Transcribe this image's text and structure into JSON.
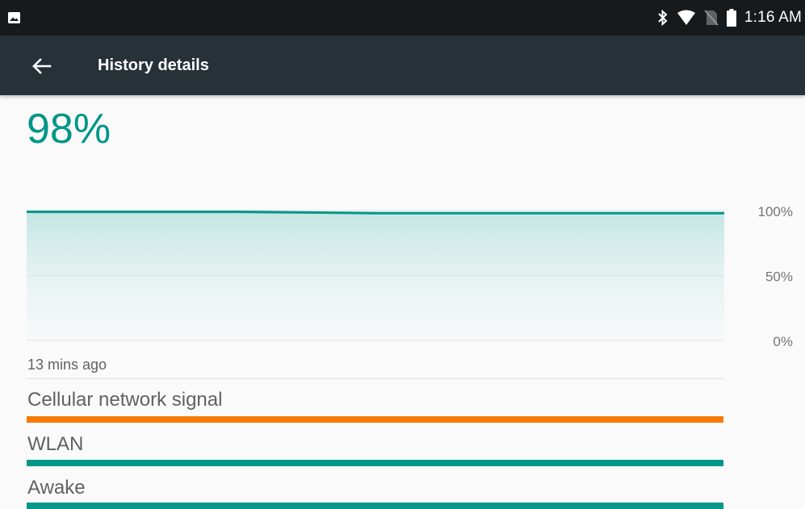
{
  "status_bar": {
    "time": "1:16 AM",
    "icons": [
      "image-icon",
      "bluetooth-icon",
      "wifi-icon",
      "no-sim-icon",
      "battery-icon"
    ]
  },
  "toolbar": {
    "title": "History details",
    "back_icon": "arrow-back-icon"
  },
  "battery": {
    "level_text": "98%"
  },
  "chart_data": {
    "type": "area",
    "x_start_label": "13 mins ago",
    "y_ticks": [
      "100%",
      "50%",
      "0%"
    ],
    "ylim": [
      0,
      100
    ],
    "values": [
      99,
      99,
      99,
      99,
      98.5,
      98,
      98,
      98,
      98,
      98,
      98
    ],
    "color": "#009688",
    "grid": true
  },
  "time_label": "13 mins ago",
  "tracks": [
    {
      "label": "Cellular network signal",
      "color": "#f57c00"
    },
    {
      "label": "WLAN",
      "color": "#009688"
    },
    {
      "label": "Awake",
      "color": "#009688"
    }
  ],
  "colors": {
    "accent": "#009688",
    "toolbar": "#263238",
    "status_bar": "#161a1c"
  }
}
